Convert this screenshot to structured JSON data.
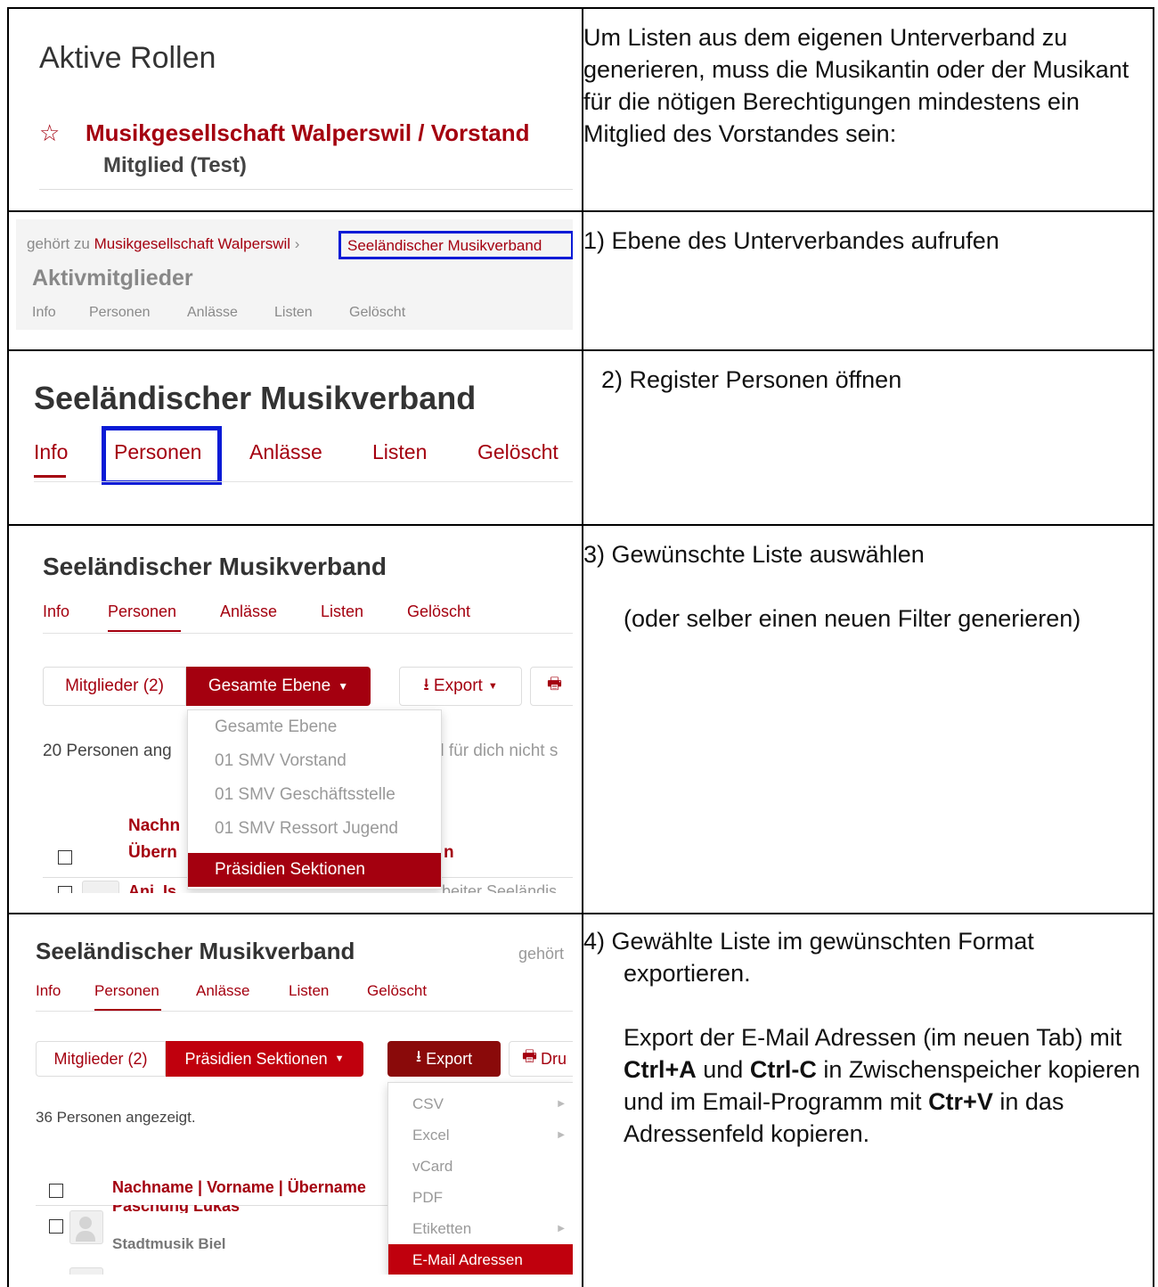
{
  "intro": {
    "title": "Aktive Rollen",
    "group_link": "Musikgesellschaft Walperswil / Vorstand",
    "role": "Mitglied (Test)",
    "text": "Um Listen aus dem eigenen Unterverband zu generieren, muss die Musikantin oder der Musikant für die nötigen Berechtigungen mindestens ein Mitglied des Vorstandes sein:"
  },
  "step1": {
    "belongs_prefix": "gehört zu",
    "parent_link": "Musikgesellschaft Walperswil",
    "sep": "›",
    "verband_link": "Seeländischer Musikverband",
    "group_title": "Aktivmitglieder",
    "tabs": [
      "Info",
      "Personen",
      "Anlässe",
      "Listen",
      "Gelöscht"
    ],
    "text": "1) Ebene des Unterverbandes aufrufen"
  },
  "step2": {
    "title": "Seeländischer Musikverband",
    "tabs": [
      "Info",
      "Personen",
      "Anlässe",
      "Listen",
      "Gelöscht"
    ],
    "text": "2) Register Personen öffnen"
  },
  "step3": {
    "title": "Seeländischer Musikverband",
    "tabs": [
      "Info",
      "Personen",
      "Anlässe",
      "Listen",
      "Gelöscht"
    ],
    "members_btn": "Mitglieder (2)",
    "scope_btn": "Gesamte Ebene",
    "export_btn": "Export",
    "count_text": "20 Personen ang",
    "hidden_text": "d für dich nicht s",
    "col_name1": "Nachn",
    "col_name2": "Übern",
    "col_n": "n",
    "row_name": "Ani, Is",
    "row_group": "beiter Seeländis",
    "dropdown": [
      "Gesamte Ebene",
      "01 SMV Vorstand",
      "01 SMV Geschäftsstelle",
      "01 SMV Ressort Jugend",
      "Präsidien Sektionen"
    ],
    "text1": "3) Gewünschte Liste auswählen",
    "text2": "(oder selber einen neuen Filter generieren)"
  },
  "step4": {
    "title": "Seeländischer Musikverband",
    "belongs": "gehört",
    "tabs": [
      "Info",
      "Personen",
      "Anlässe",
      "Listen",
      "Gelöscht"
    ],
    "members_btn": "Mitglieder (2)",
    "scope_btn": "Präsidien Sektionen",
    "export_btn": "Export",
    "print_btn": "Dru",
    "count_text": "36 Personen angezeigt.",
    "col_header": "Nachname | Vorname | Übername",
    "row_name": "Paschung Lukas",
    "row_group": "Stadtmusik Biel",
    "export_menu": [
      "CSV",
      "Excel",
      "vCard",
      "PDF",
      "Etiketten",
      "E-Mail Adressen"
    ],
    "text_head1": "4) Gewählte Liste im gewünschten Format",
    "text_head2": "exportieren.",
    "text_a": "Export der E-Mail Adressen (im neuen Tab) mit ",
    "key1": "Ctrl+A",
    "text_b": " und ",
    "key2": "Ctrl-C",
    "text_c": " in Zwischenspeicher kopieren und im Email-Programm mit ",
    "key3": "Ctr+V",
    "text_d": " in das Adressenfeld kopieren."
  },
  "colors": {
    "brand_red": "#a4000f",
    "highlight_blue": "#0a1bd6",
    "text": "#111111"
  }
}
